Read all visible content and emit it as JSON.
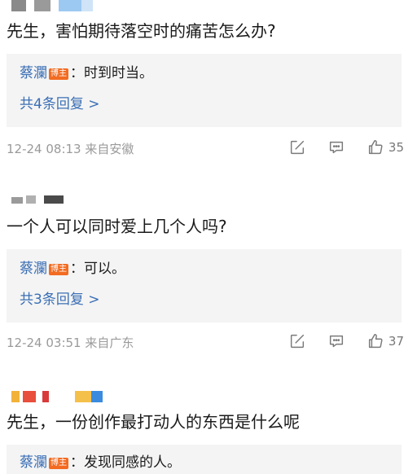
{
  "comments": [
    {
      "text": "先生，害怕期待落空时的痛苦怎么办?",
      "reply_author": "蔡瀾",
      "badge": "博主",
      "reply_text": "：时到时当。",
      "more_replies": "共4条回复 >",
      "meta": "12-24 08:13 来自安徽",
      "likes": "35"
    },
    {
      "text": "一个人可以同时爱上几个人吗?",
      "reply_author": "蔡瀾",
      "badge": "博主",
      "reply_text": "：可以。",
      "more_replies": "共3条回复 >",
      "meta": "12-24 03:51 来自广东",
      "likes": "37"
    },
    {
      "text": "先生，一份创作最打动人的东西是什么呢",
      "reply_author": "蔡瀾",
      "badge": "博主",
      "reply_text": "：发现同感的人。"
    }
  ],
  "icons": {
    "share": "share-icon",
    "comment": "comment-icon",
    "like": "thumbs-up-icon"
  }
}
